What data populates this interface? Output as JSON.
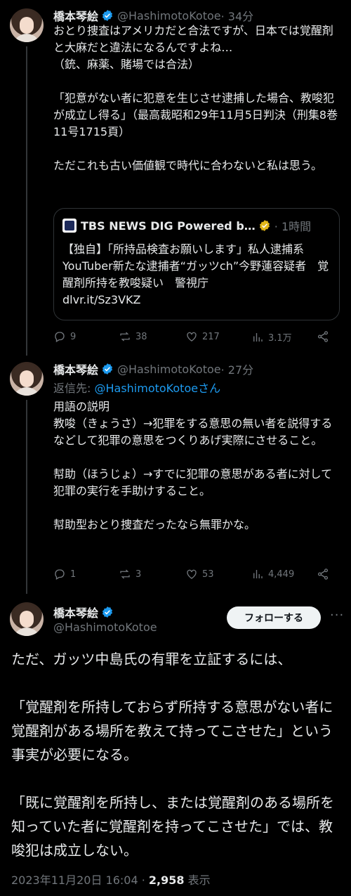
{
  "tweets": [
    {
      "name": "橋本琴絵",
      "handle": "@HashimotoKotoe",
      "time": "· 34分",
      "text": "おとり捜査はアメリカだと合法ですが、日本では覚醒剤と大麻だと違法になるんですよね…\n（銃、麻薬、賭場では合法）\n\n「犯意がない者に犯意を生じさせ逮捕した場合、教唆犯が成立し得る」（最高裁昭和29年11月5日判決（刑集8巻11号1715頁）\n\nただこれも古い価値観で時代に合わないと私は思う。",
      "card": {
        "source": "TBS NEWS DIG Powered b…",
        "time": "· 1時間",
        "text": "【独自】「所持品検査お願いします」私人逮捕系YouTuber新たな逮捕者“ガッツch”今野蓮容疑者　覚醒剤所持を教唆疑い　警視庁\ndlvr.it/Sz3VKZ"
      },
      "replies": "9",
      "reposts": "38",
      "likes": "217",
      "views": "3.1万"
    },
    {
      "name": "橋本琴絵",
      "handle": "@HashimotoKotoe",
      "time": "· 27分",
      "reply_prefix": "返信先: ",
      "reply_to": "@HashimotoKotoeさん",
      "text": "用語の説明\n教唆（きょうさ）→犯罪をする意思の無い者を説得するなどして犯罪の意思をつくりあげ実際にさせること。\n\n幇助（ほうじょ）→すでに犯罪の意思がある者に対して犯罪の実行を手助けすること。\n\n幇助型おとり捜査だったなら無罪かな。",
      "replies": "1",
      "reposts": "3",
      "likes": "53",
      "views": "4,449"
    }
  ],
  "main": {
    "name": "橋本琴絵",
    "handle": "@HashimotoKotoe",
    "follow_label": "フォローする",
    "more": "···",
    "text": "ただ、ガッツ中島氏の有罪を立証するには、\n\n「覚醒剤を所持しておらず所持する意思がない者に覚醒剤がある場所を教えて持ってこさせた」という事実が必要になる。\n\n「既に覚醒剤を所持し、または覚醒剤のある場所を知っていた者に覚醒剤を持ってこさせた」では、教唆犯は成立しない。",
    "date": "2023年11月20日 16:04 · ",
    "views_count": "2,958",
    "views_label": " 表示"
  },
  "colors": {
    "verified": "#1d9bf0",
    "link": "#1d9bf0",
    "muted": "#71767b",
    "verified_gold": "#e2b719"
  }
}
